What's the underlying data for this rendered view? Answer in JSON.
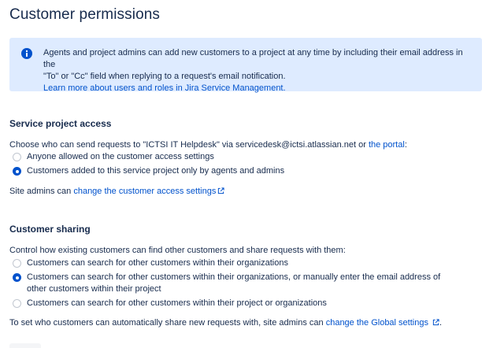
{
  "page": {
    "title": "Customer permissions"
  },
  "info_banner": {
    "line1": "Agents and project admins can add new customers to a project at any time by including their email address in the",
    "line2": "\"To\" or \"Cc\" field when replying to a request's email notification.",
    "link": "Learn more about users and roles in Jira Service Management."
  },
  "service_access": {
    "heading": "Service project access",
    "description_prefix": "Choose who can send requests to \"ICTSI IT Helpdesk\" via servicedesk@ictsi.atlassian.net or",
    "description_link": "the portal",
    "description_suffix": ":",
    "options": [
      {
        "label": "Anyone allowed on the customer access settings",
        "selected": false
      },
      {
        "label": "Customers added to this service project only by agents and admins",
        "selected": true
      }
    ],
    "footer_prefix": "Site admins can",
    "footer_link": "change the customer access settings"
  },
  "customer_sharing": {
    "heading": "Customer sharing",
    "description": "Control how existing customers can find other customers and share requests with them:",
    "options": [
      {
        "label": "Customers can search for other customers within their organizations",
        "selected": false
      },
      {
        "label": "Customers can search for other customers within their organizations, or manually enter the email address of other customers within their project",
        "selected": true
      },
      {
        "label": "Customers can search for other customers within their project or organizations",
        "selected": false
      }
    ],
    "footer_prefix": "To set who customers can automatically share new requests with, site admins can",
    "footer_link": "change the Global settings"
  },
  "icons": {
    "info": "info-icon",
    "external": "external-link-icon"
  },
  "colors": {
    "accent": "#0052cc",
    "banner_bg": "#deebff",
    "text": "#172b4d"
  }
}
